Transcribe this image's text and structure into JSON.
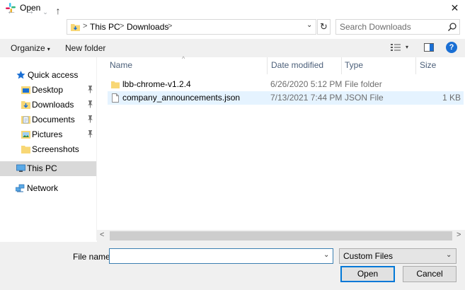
{
  "window": {
    "title": "Open",
    "close_glyph": "✕"
  },
  "nav": {
    "back_glyph": "←",
    "forward_glyph": "→",
    "recent_glyph": "⌄",
    "up_glyph": "↑",
    "breadcrumb": [
      "This PC",
      "Downloads"
    ],
    "breadcrumb_sep": ">",
    "address_dropdown": "⌄",
    "refresh_glyph": "↻",
    "search_placeholder": "Search Downloads"
  },
  "toolbar": {
    "organize_label": "Organize",
    "organize_caret": "▾",
    "new_folder_label": "New folder",
    "view_caret": "▾",
    "help_glyph": "?"
  },
  "sidebar": {
    "items": [
      {
        "label": "Quick access",
        "icon": "star-icon"
      },
      {
        "label": "Desktop",
        "icon": "desktop-folder-icon",
        "pinned": true
      },
      {
        "label": "Downloads",
        "icon": "downloads-folder-icon",
        "pinned": true
      },
      {
        "label": "Documents",
        "icon": "documents-folder-icon",
        "pinned": true
      },
      {
        "label": "Pictures",
        "icon": "pictures-folder-icon",
        "pinned": true
      },
      {
        "label": "Screenshots",
        "icon": "folder-icon"
      },
      {
        "label": "This PC",
        "icon": "computer-icon",
        "selected": true
      },
      {
        "label": "Network",
        "icon": "network-icon"
      }
    ]
  },
  "list": {
    "sort_indicator": "^",
    "columns": [
      "Name",
      "Date modified",
      "Type",
      "Size"
    ],
    "rows": [
      {
        "name": "lbb-chrome-v1.2.4",
        "date": "6/26/2020 5:12 PM",
        "type": "File folder",
        "size": "",
        "icon": "folder-icon"
      },
      {
        "name": "company_announcements.json",
        "date": "7/13/2021 7:44 PM",
        "type": "JSON File",
        "size": "1 KB",
        "icon": "file-icon",
        "highlighted": true
      }
    ]
  },
  "scroll": {
    "left_glyph": "<",
    "right_glyph": ">"
  },
  "footer": {
    "file_name_label": "File name:",
    "file_name_value": "",
    "file_name_dropdown": "⌄",
    "filter_value": "Custom Files",
    "filter_dropdown": "⌄",
    "open_label": "Open",
    "cancel_label": "Cancel"
  },
  "colors": {
    "selection": "#d9d9d9",
    "hover_row": "#e5f3ff",
    "header_text": "#4c607a",
    "accent": "#0078d7",
    "folder": "#f8d775"
  }
}
